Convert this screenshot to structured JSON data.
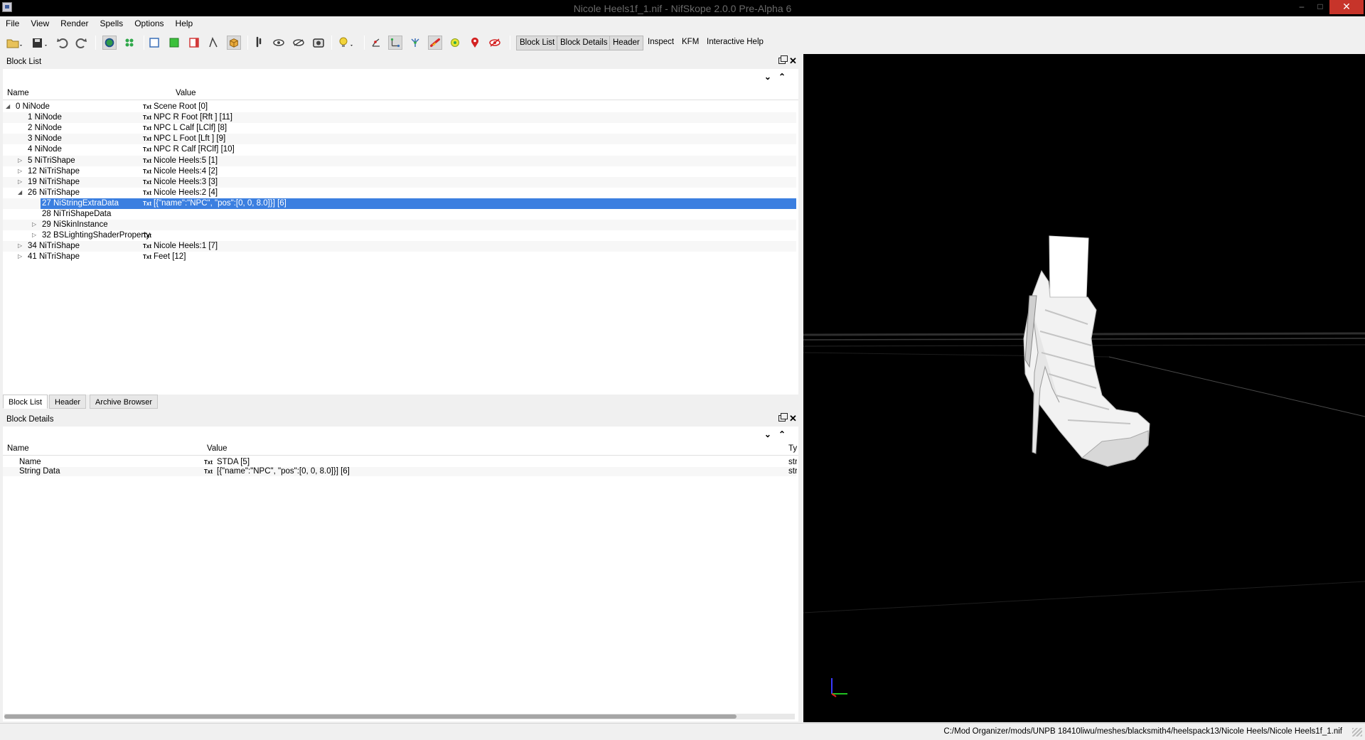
{
  "window": {
    "title": "Nicole Heels1f_1.nif - NifSkope 2.0.0 Pre-Alpha 6",
    "minimize": "–",
    "maximize": "□",
    "close": "✕"
  },
  "menu": [
    "File",
    "View",
    "Render",
    "Spells",
    "Options",
    "Help"
  ],
  "toolbar": {
    "icons": [
      "open-icon",
      "save-icon",
      "undo-icon",
      "redo-icon",
      "globe-icon",
      "spells-icon",
      "front-view-icon",
      "top-view-icon",
      "side-view-icon",
      "user-view-icon",
      "walk-icon",
      "cube-view-icon",
      "rotate-icon",
      "eye-icon",
      "hidden-eye-icon",
      "screenshot-icon",
      "light-bulb-icon",
      "axes-icon",
      "nodes-icon",
      "skeleton-icon",
      "collision-icon",
      "markers-icon",
      "furniture-icon",
      "constraints-icon"
    ],
    "text_buttons": [
      "Block List",
      "Block Details",
      "Header",
      "Inspect",
      "KFM",
      "Interactive Help"
    ]
  },
  "block_list": {
    "title": "Block List",
    "columns": {
      "name": "Name",
      "value": "Value"
    },
    "txt_tag": "Txt",
    "rows": [
      {
        "name": "0 NiNode",
        "value": "Scene Root [0]",
        "depth": 0,
        "expander": "open",
        "txt": true
      },
      {
        "name": "1 NiNode",
        "value": "NPC R Foot [Rft ] [11]",
        "depth": 1,
        "expander": "none",
        "txt": true
      },
      {
        "name": "2 NiNode",
        "value": "NPC L Calf [LClf] [8]",
        "depth": 1,
        "expander": "none",
        "txt": true
      },
      {
        "name": "3 NiNode",
        "value": "NPC L Foot [Lft ] [9]",
        "depth": 1,
        "expander": "none",
        "txt": true
      },
      {
        "name": "4 NiNode",
        "value": "NPC R Calf [RClf] [10]",
        "depth": 1,
        "expander": "none",
        "txt": true
      },
      {
        "name": "5 NiTriShape",
        "value": "Nicole Heels:5 [1]",
        "depth": 1,
        "expander": "closed",
        "txt": true
      },
      {
        "name": "12 NiTriShape",
        "value": "Nicole Heels:4 [2]",
        "depth": 1,
        "expander": "closed",
        "txt": true
      },
      {
        "name": "19 NiTriShape",
        "value": "Nicole Heels:3 [3]",
        "depth": 1,
        "expander": "closed",
        "txt": true
      },
      {
        "name": "26 NiTriShape",
        "value": "Nicole Heels:2 [4]",
        "depth": 1,
        "expander": "open",
        "txt": true
      },
      {
        "name": "27 NiStringExtraData",
        "value": "[{\"name\":\"NPC\", \"pos\":[0, 0, 8.0]}] [6]",
        "depth": 2,
        "expander": "none",
        "txt": true,
        "selected": true
      },
      {
        "name": "28 NiTriShapeData",
        "value": "",
        "depth": 2,
        "expander": "none",
        "txt": false
      },
      {
        "name": "29 NiSkinInstance",
        "value": "",
        "depth": 2,
        "expander": "closed",
        "txt": false
      },
      {
        "name": "32 BSLightingShaderProperty",
        "value": "",
        "depth": 2,
        "expander": "closed",
        "txt": true
      },
      {
        "name": "34 NiTriShape",
        "value": "Nicole Heels:1 [7]",
        "depth": 1,
        "expander": "closed",
        "txt": true
      },
      {
        "name": "41 NiTriShape",
        "value": "Feet [12]",
        "depth": 1,
        "expander": "closed",
        "txt": true
      }
    ]
  },
  "bottom_tabs": [
    "Block List",
    "Header",
    "Archive Browser"
  ],
  "block_details": {
    "title": "Block Details",
    "columns": {
      "name": "Name",
      "value": "Value",
      "type": "Ty"
    },
    "txt_tag": "Txt",
    "rows": [
      {
        "name": "Name",
        "value": "STDA [5]",
        "type": "str"
      },
      {
        "name": "String Data",
        "value": "[{\"name\":\"NPC\", \"pos\":[0, 0, 8.0]}] [6]",
        "type": "str"
      }
    ]
  },
  "viewport": {
    "background": "#000000",
    "model": "heel-shoe"
  },
  "statusbar": {
    "path": "C:/Mod Organizer/mods/UNPB 18410liwu/meshes/blacksmith4/heelspack13/Nicole Heels/Nicole Heels1f_1.nif"
  },
  "colors": {
    "selection": "#3b7fe0",
    "close_button": "#c7342a"
  }
}
